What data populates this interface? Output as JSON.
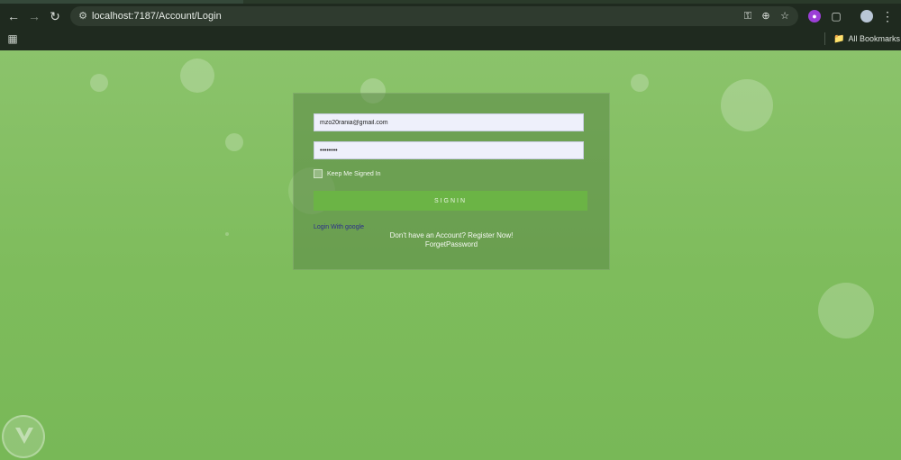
{
  "browser": {
    "url": "localhost:7187/Account/Login",
    "all_bookmarks_label": "All Bookmarks",
    "icons": {
      "back": "back-arrow-icon",
      "forward": "forward-arrow-icon",
      "reload": "reload-icon",
      "site_info": "site-info-icon",
      "password_key": "key-icon",
      "zoom": "zoom-icon",
      "star": "bookmark-star-icon",
      "extension": "extension-icon",
      "puzzle": "extensions-puzzle-icon",
      "profile": "profile-avatar-icon",
      "menu": "kebab-menu-icon",
      "apps": "apps-grid-icon",
      "folder": "folder-icon"
    }
  },
  "login": {
    "email_value": "mzo20rania@gmail.com",
    "password_value": "••••••••",
    "keep_signed_in_label": "Keep Me Signed In",
    "signin_label": "SIGNIN",
    "google_link": "Login With google",
    "register_text": "Don't have an Account? Register Now!",
    "forget_text": "ForgetPassword"
  },
  "colors": {
    "page_green": "#80bd5f",
    "button_green": "#6bb445",
    "browser_dark": "#1f2a1f",
    "link_purple": "#2d2f8a"
  }
}
